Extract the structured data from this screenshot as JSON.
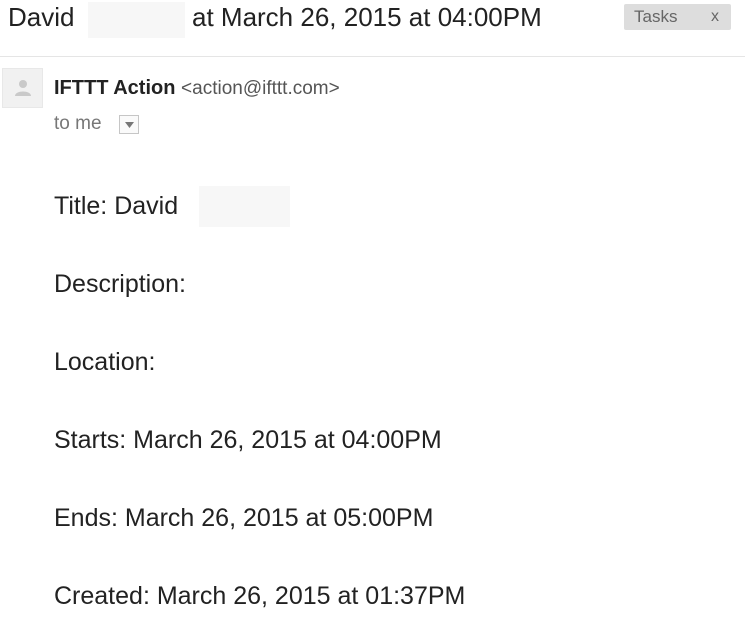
{
  "subject": {
    "first_name": "David",
    "rest": "at March 26, 2015 at 04:00PM",
    "label": "Tasks",
    "label_remove": "x"
  },
  "sender": {
    "name": "IFTTT Action",
    "email": "<action@ifttt.com>",
    "recipient": "to me",
    "avatar_icon": "person-icon",
    "details_icon": "chevron-down-icon"
  },
  "body": {
    "title": "Title: David",
    "description": "Description:",
    "location": "Location:",
    "starts": "Starts: March 26, 2015 at 04:00PM",
    "ends": "Ends: March 26, 2015 at 05:00PM",
    "created": "Created: March 26, 2015 at 01:37PM"
  }
}
